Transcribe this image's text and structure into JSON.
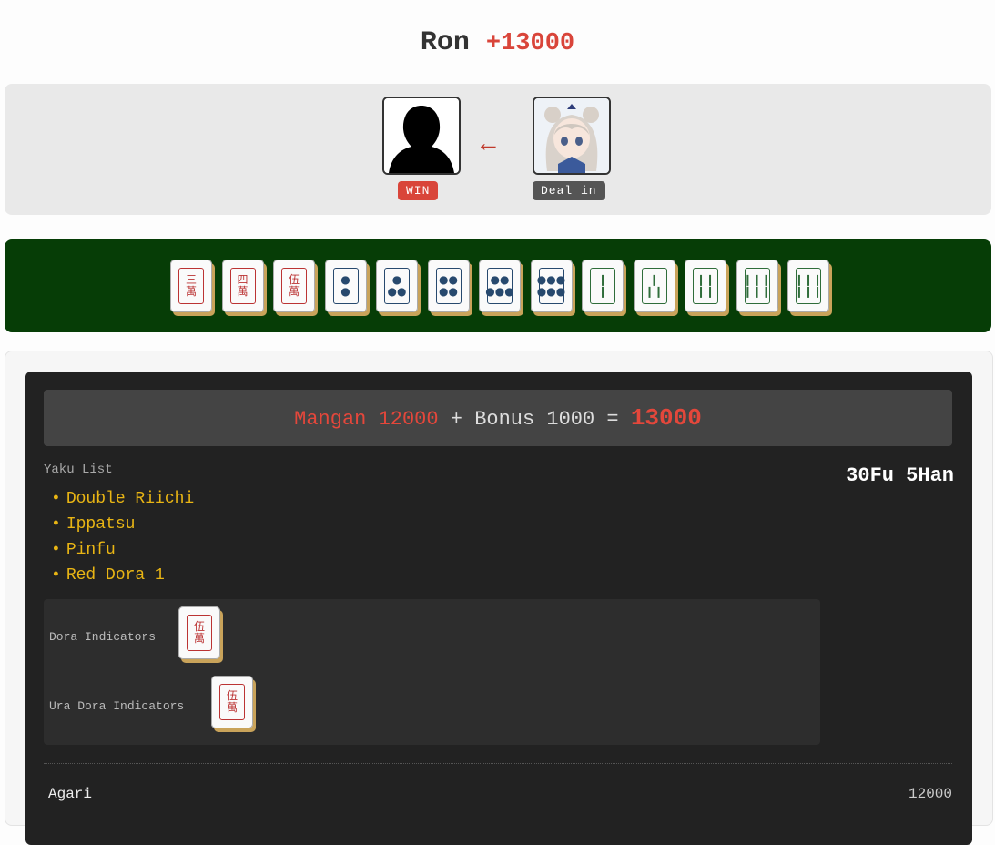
{
  "header": {
    "result": "Ron",
    "gain": "+13000"
  },
  "players": {
    "winner_badge": "WIN",
    "winner_badge_color": "#d9453a",
    "loser_badge": "Deal in",
    "loser_badge_color": "#555555",
    "arrow": "←"
  },
  "hand": [
    {
      "top": "三",
      "bottom": "萬",
      "suit": "man"
    },
    {
      "top": "四",
      "bottom": "萬",
      "suit": "man"
    },
    {
      "top": "伍",
      "bottom": "萬",
      "suit": "man"
    },
    {
      "top": "●",
      "bottom": "●",
      "suit": "pin"
    },
    {
      "top": "●",
      "bottom": "●●",
      "suit": "pin"
    },
    {
      "top": "●●",
      "bottom": "●●",
      "suit": "pin"
    },
    {
      "top": "●●",
      "bottom": "●●●",
      "suit": "pin"
    },
    {
      "top": "●●●",
      "bottom": "●●●",
      "suit": "pin"
    },
    {
      "top": "❙",
      "bottom": "❙",
      "suit": "sou"
    },
    {
      "top": "❙",
      "bottom": "❙❙",
      "suit": "sou"
    },
    {
      "top": "❙❙",
      "bottom": "❙❙",
      "suit": "sou"
    },
    {
      "top": "❙❙❙",
      "bottom": "❙❙❙",
      "suit": "sou"
    },
    {
      "top": "❙❙❙",
      "bottom": "❙❙❙",
      "suit": "sou"
    }
  ],
  "score": {
    "limit_name": "Mangan",
    "limit_value": "12000",
    "plus": "+",
    "bonus_label": "Bonus",
    "bonus_value": "1000",
    "equals": "=",
    "total": "13000"
  },
  "yaku_label": "Yaku List",
  "fu_han": "30Fu 5Han",
  "yaku": [
    "Double Riichi",
    "Ippatsu",
    "Pinfu",
    "Red Dora 1"
  ],
  "dora": {
    "indicators_label": "Dora Indicators",
    "ura_label": "Ura Dora Indicators",
    "indicator_tile": {
      "top": "伍",
      "bottom": "萬"
    },
    "ura_tile": {
      "top": "伍",
      "bottom": "萬"
    }
  },
  "agari": {
    "label": "Agari",
    "value": "12000"
  }
}
